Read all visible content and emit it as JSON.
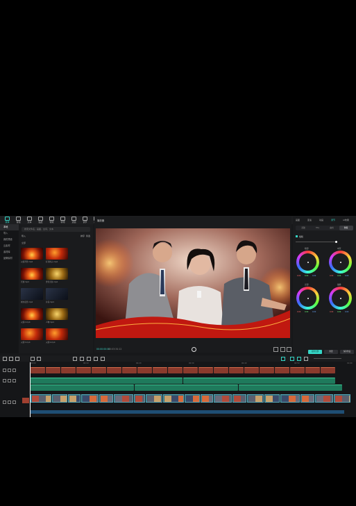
{
  "toolbar": {
    "items": [
      {
        "label": "媒体",
        "icon": "media-icon",
        "active": true
      },
      {
        "label": "音频",
        "icon": "audio-icon"
      },
      {
        "label": "文本",
        "icon": "text-icon"
      },
      {
        "label": "贴纸",
        "icon": "sticker-icon"
      },
      {
        "label": "特效",
        "icon": "effects-icon"
      },
      {
        "label": "转场",
        "icon": "transition-icon"
      },
      {
        "label": "滤镜",
        "icon": "filter-icon"
      },
      {
        "label": "调节",
        "icon": "adjust-icon"
      },
      {
        "label": "模板",
        "icon": "template-icon"
      }
    ]
  },
  "left_nav": {
    "items": [
      {
        "label": "本地",
        "selected": true
      },
      {
        "label": "导入"
      },
      {
        "label": "我的预设"
      },
      {
        "label": "云素材"
      },
      {
        "label": "素材库"
      },
      {
        "label": "品牌素材"
      }
    ]
  },
  "media": {
    "search_placeholder": "搜索文件名、画面、台词、文本",
    "header": "导入",
    "sort_label": "排序",
    "filter_label": "筛选",
    "section_label": "全部",
    "thumbs": [
      {
        "cap": "火焰背景.mp4",
        "style": "fire"
      },
      {
        "cap": "红色粒子.mp4",
        "style": "fire2"
      },
      {
        "cap": "光效.mp4",
        "style": "fire"
      },
      {
        "cap": "金色光斑.mp4",
        "style": "gold"
      },
      {
        "cap": "城市夜景.mp4",
        "style": "dark"
      },
      {
        "cap": "片段.mp4",
        "style": "dark"
      },
      {
        "cap": "火焰2.mp4",
        "style": "fire"
      },
      {
        "cap": "人物.mp4",
        "style": "gold"
      },
      {
        "cap": "火焰3.mp4",
        "style": "fire2"
      },
      {
        "cap": "火焰4.mp4",
        "style": "fire2"
      }
    ]
  },
  "preview": {
    "title": "播放器",
    "timecode_current": "00:00:00:00",
    "timecode_total": "00:03:34:12"
  },
  "inspector": {
    "tabs": [
      "画面",
      "变速",
      "动画",
      "调节",
      "AI效果"
    ],
    "active_tab": "调节",
    "subtabs": [
      "基础",
      "HSL",
      "曲线",
      "色轮"
    ],
    "active_subtab": "色轮",
    "enable_label": "色轮",
    "wheels": [
      {
        "label": "暗部",
        "vals": [
          "0.00",
          "0.00",
          "0.00"
        ]
      },
      {
        "label": "中灰",
        "vals": [
          "0.00",
          "0.00",
          "0.00"
        ]
      },
      {
        "label": "亮部",
        "vals": [
          "0.00",
          "0.00",
          "0.00"
        ]
      },
      {
        "label": "偏移",
        "vals": [
          "0.00",
          "0.00",
          "0.00"
        ]
      }
    ],
    "btn_apply": "应用全部",
    "btn_reset": "重置",
    "btn_save": "保存预设"
  },
  "timeline": {
    "ruler_ticks": [
      "00:00",
      "00:10",
      "00:20",
      "00:30",
      "00:40",
      "00:50",
      "01:00"
    ],
    "track_labels": [
      "T1",
      "T2",
      "V1"
    ]
  },
  "colors": {
    "accent": "#35d6c6",
    "panel": "#1a1b1d",
    "bg": "#000000"
  }
}
